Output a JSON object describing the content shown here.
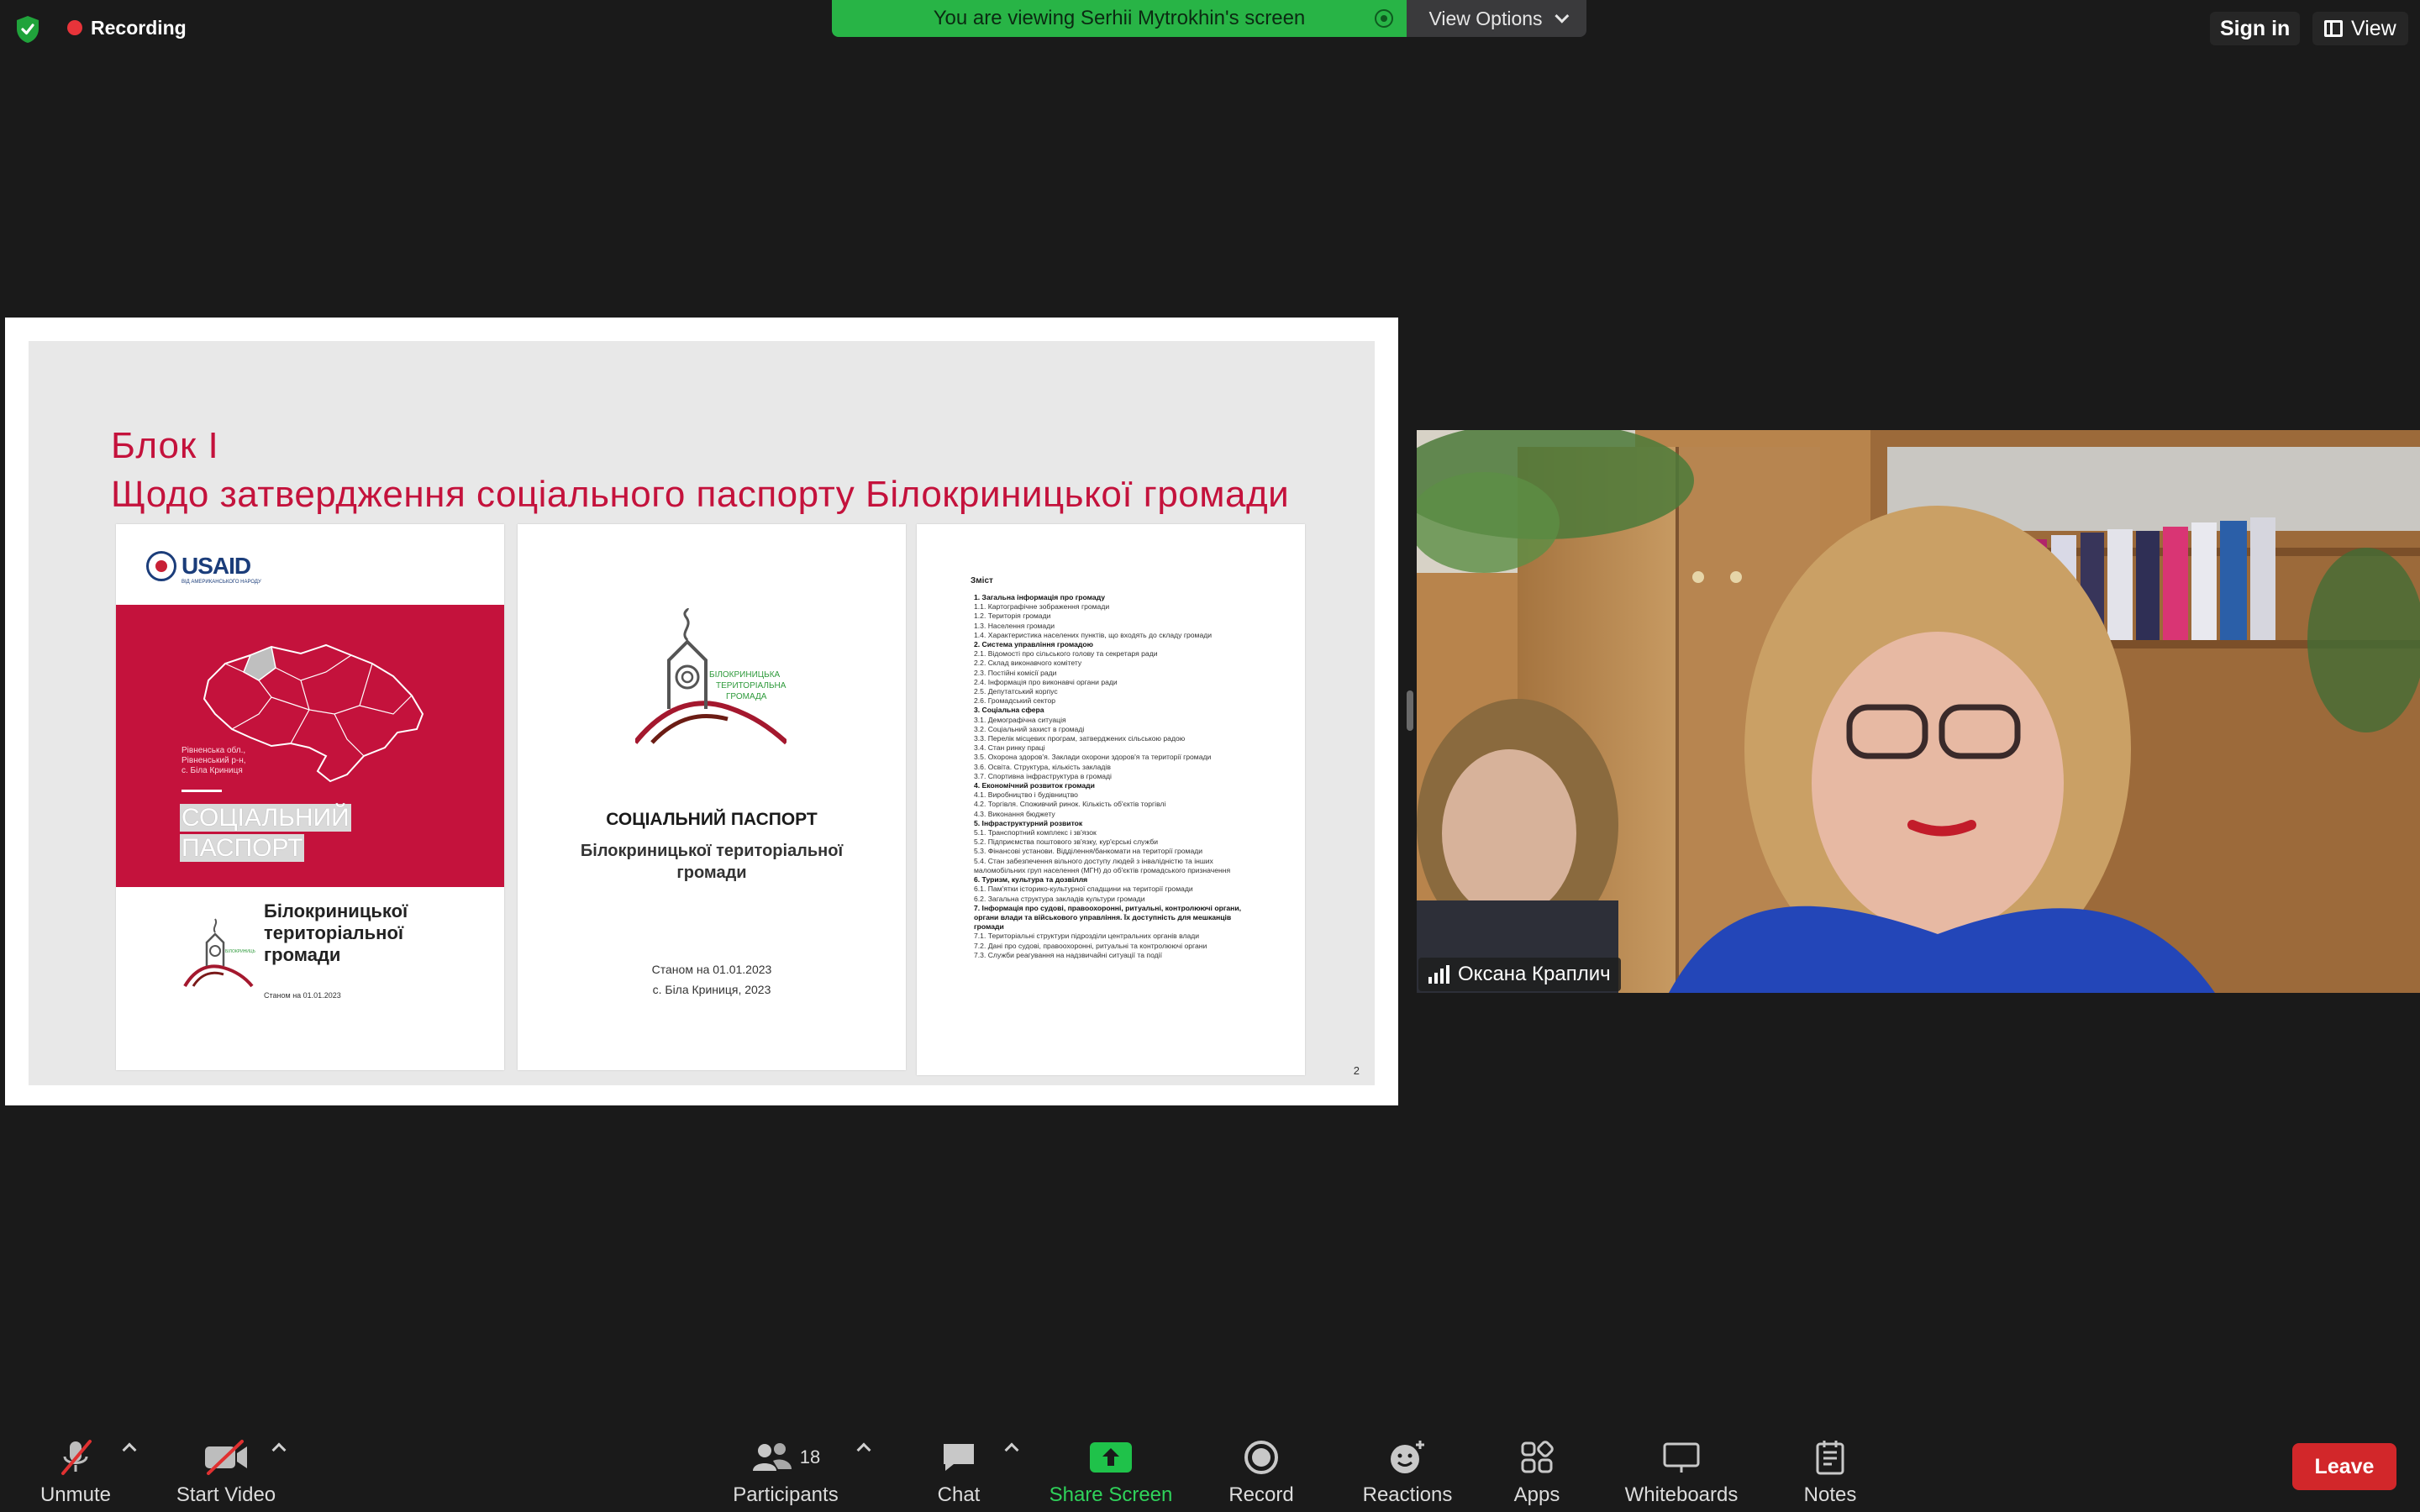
{
  "top": {
    "recording_label": "Recording",
    "viewing_banner": "You are viewing Serhii Mytrokhin's screen",
    "view_options": "View Options",
    "sign_in": "Sign in",
    "view": "View"
  },
  "slide": {
    "title_line1": "Блок  І",
    "title_line2": "Щодо затвердження соціального паспорту Білокриницької громади",
    "page_number": "2",
    "page1": {
      "brand": "USAID",
      "brand_sub": "ВІД АМЕРИКАНСЬКОГО НАРОДУ",
      "region_text": "Рівненська обл.,\nРівненський р-н,\nс. Біла Криниця",
      "big_title_1": "СОЦІАЛЬНИЙ",
      "big_title_2": "ПАСПОРТ",
      "community_1": "Білокриницької",
      "community_2": "територіальної",
      "community_3": "громади",
      "date": "Станом на 01.01.2023"
    },
    "page2": {
      "logo_text_1": "БІЛОКРИНИЦЬКА",
      "logo_text_2": "ТЕРИТОРІАЛЬНА",
      "logo_text_3": "ГРОМАДА",
      "title": "СОЦІАЛЬНИЙ ПАСПОРТ",
      "subtitle_1": "Білокриницької територіальної",
      "subtitle_2": "громади",
      "date": "Станом на 01.01.2023",
      "place": "с. Біла Криниця, 2023"
    },
    "page3": {
      "heading": "Зміст",
      "toc": [
        {
          "t": "1. Загальна інформація про громаду",
          "b": true
        },
        {
          "t": "1.1. Картографічне зображення громади"
        },
        {
          "t": "1.2. Територія громади"
        },
        {
          "t": "1.3. Населення громади"
        },
        {
          "t": "1.4.  Характеристика населених пунктів, що входять до складу громади"
        },
        {
          "t": "2. Система управління громадою",
          "b": true
        },
        {
          "t": "2.1. Відомості про сільського голову та секретаря ради"
        },
        {
          "t": "2.2. Склад виконавчого комітету"
        },
        {
          "t": "2.3. Постійні комісії ради"
        },
        {
          "t": "2.4. Інформація про виконавчі органи ради"
        },
        {
          "t": "2.5. Депутатський корпус"
        },
        {
          "t": "2.6. Громадський сектор"
        },
        {
          "t": "3. Соціальна сфера",
          "b": true
        },
        {
          "t": "3.1. Демографічна ситуація"
        },
        {
          "t": "3.2. Соціальний захист в громаді"
        },
        {
          "t": "3.3. Перелік місцевих програм, затверджених сільською радою"
        },
        {
          "t": "3.4. Стан ринку праці"
        },
        {
          "t": "3.5. Охорона здоров'я. Заклади охорони здоров'я та території громади"
        },
        {
          "t": "3.6. Освіта. Структура, кількість закладів"
        },
        {
          "t": "3.7. Спортивна інфраструктура в громаді"
        },
        {
          "t": "4. Економічний розвиток громади",
          "b": true
        },
        {
          "t": "4.1. Виробництво і будівництво"
        },
        {
          "t": "4.2. Торгівля. Споживчий ринок. Кількість об'єктів торгівлі"
        },
        {
          "t": "4.3. Виконання бюджету"
        },
        {
          "t": "5. Інфраструктурний розвиток",
          "b": true
        },
        {
          "t": "5.1. Транспортний комплекс і зв'язок"
        },
        {
          "t": "5.2. Підприємства поштового зв'язку, кур'єрські служби"
        },
        {
          "t": "5.3. Фінансові установи. Відділення/банкомати на території громади"
        },
        {
          "t": "5.4. Стан забезпечення вільного доступу людей з інвалідністю та інших маломобільних груп населення (МГН) до об'єктів громадського призначення"
        },
        {
          "t": "6. Туризм, культура та дозвілля",
          "b": true
        },
        {
          "t": "6.1. Пам'ятки історико-культурної спадщини на території громади"
        },
        {
          "t": "6.2. Загальна структура закладів культури громади"
        },
        {
          "t": "7. Інформація про судові, правоохоронні, ритуальні, контролюючі органи, органи влади та військового управління. Їх доступність для мешканців громади",
          "b": true
        },
        {
          "t": "7.1. Територіальні структури підрозділи центральних органів влади"
        },
        {
          "t": "7.2. Дані про судові, правоохоронні, ритуальні та контролюючі органи"
        },
        {
          "t": "7.3. Служби реагування на надзвичайні ситуації та події"
        }
      ]
    }
  },
  "video": {
    "participant_name": "Оксана Краплич"
  },
  "toolbar": {
    "unmute": "Unmute",
    "start_video": "Start Video",
    "participants": "Participants",
    "participants_count": "18",
    "chat": "Chat",
    "share_screen": "Share Screen",
    "record": "Record",
    "reactions": "Reactions",
    "apps": "Apps",
    "whiteboards": "Whiteboards",
    "notes": "Notes",
    "leave": "Leave"
  },
  "colors": {
    "banner_green": "#28b446",
    "slide_red": "#c4123c",
    "leave_red": "#d2272a",
    "share_green": "#1fc24a"
  }
}
